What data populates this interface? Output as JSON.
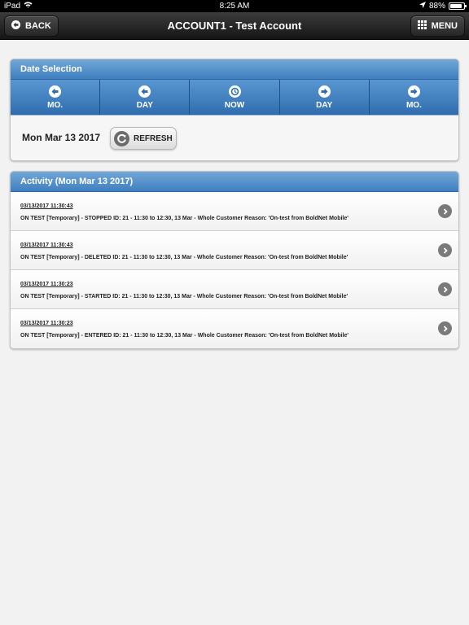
{
  "status_bar": {
    "device": "iPad",
    "time": "8:25 AM",
    "battery": "88%",
    "battery_level": 0.88
  },
  "nav_bar": {
    "title": "ACCOUNT1 - Test Account",
    "back_label": "BACK",
    "menu_label": "MENU"
  },
  "date_selection": {
    "header": "Date Selection",
    "buttons": [
      {
        "label": "MO.",
        "icon": "arrow-left-icon"
      },
      {
        "label": "DAY",
        "icon": "arrow-left-icon"
      },
      {
        "label": "NOW",
        "icon": "clock-icon"
      },
      {
        "label": "DAY",
        "icon": "arrow-right-icon"
      },
      {
        "label": "MO.",
        "icon": "arrow-right-icon"
      }
    ],
    "current_date": "Mon Mar 13 2017",
    "refresh_label": "REFRESH"
  },
  "activity": {
    "header": "Activity (Mon Mar 13 2017)",
    "items": [
      {
        "time": "03/13/2017 11:30:43",
        "desc": "ON TEST [Temporary] - STOPPED ID: 21 - 11:30 to 12:30, 13 Mar - Whole Customer Reason: 'On-test from BoldNet Mobile'"
      },
      {
        "time": "03/13/2017 11:30:43",
        "desc": "ON TEST [Temporary] - DELETED ID: 21 - 11:30 to 12:30, 13 Mar - Whole Customer Reason: 'On-test from BoldNet Mobile'"
      },
      {
        "time": "03/13/2017 11:30:23",
        "desc": "ON TEST [Temporary] - STARTED ID: 21 - 11:30 to 12:30, 13 Mar - Whole Customer Reason: 'On-test from BoldNet Mobile'"
      },
      {
        "time": "03/13/2017 11:30:23",
        "desc": "ON TEST [Temporary] - ENTERED ID: 21 - 11:30 to 12:30, 13 Mar - Whole Customer Reason: 'On-test from BoldNet Mobile'"
      }
    ]
  },
  "colors": {
    "accent_blue": "#3f7fc0",
    "nav_dark": "#1e1e1e"
  }
}
